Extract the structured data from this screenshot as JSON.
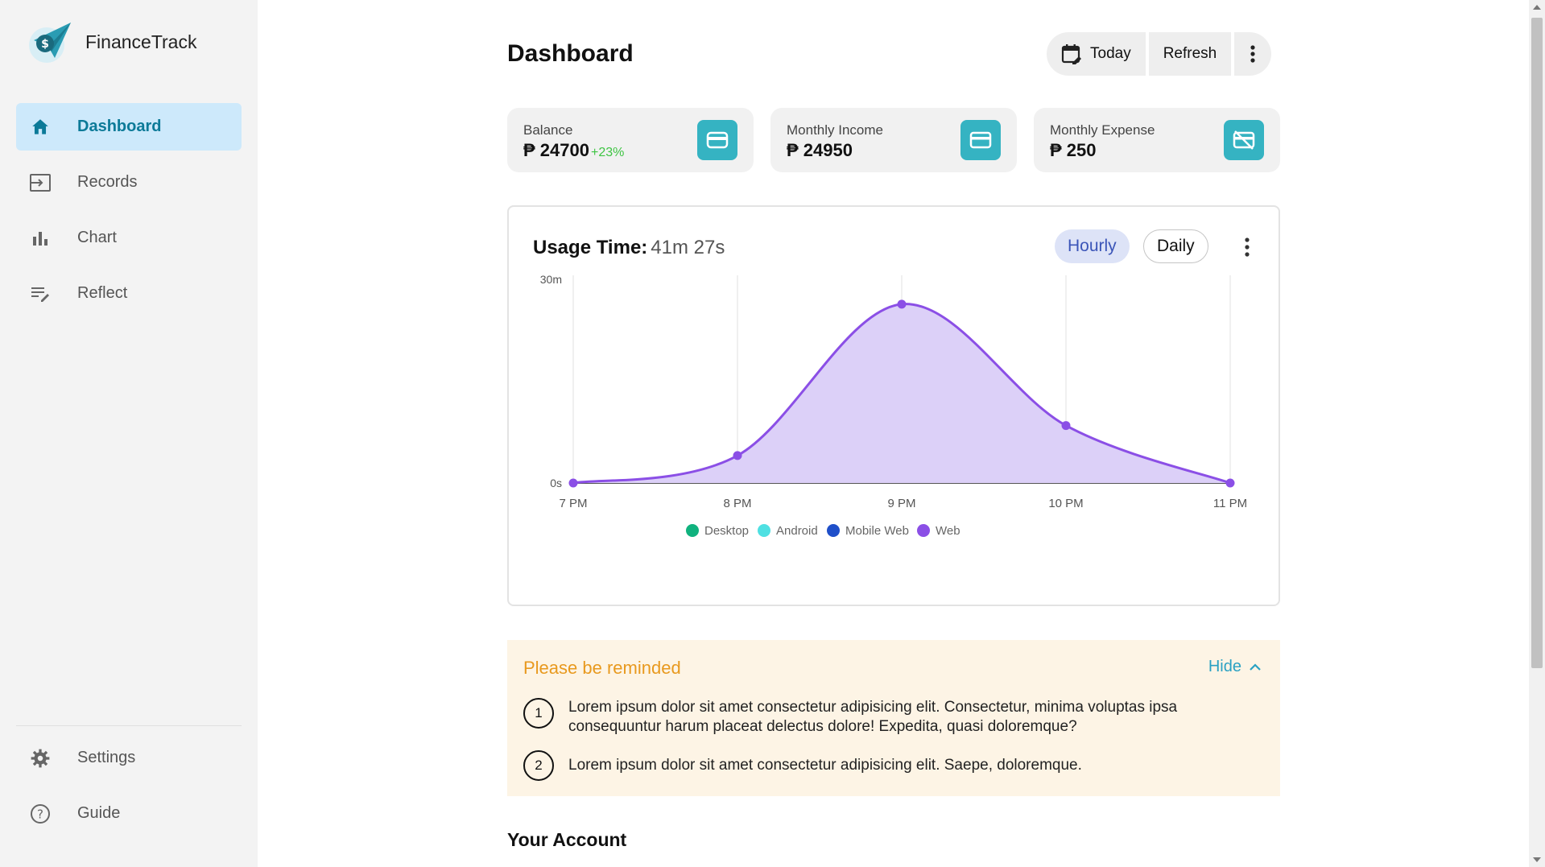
{
  "brand": {
    "name": "FinanceTrack"
  },
  "nav": {
    "items": [
      {
        "label": "Dashboard",
        "active": true
      },
      {
        "label": "Records"
      },
      {
        "label": "Chart"
      },
      {
        "label": "Reflect"
      }
    ],
    "bottom": [
      {
        "label": "Settings"
      },
      {
        "label": "Guide"
      }
    ]
  },
  "header": {
    "title": "Dashboard",
    "today_label": "Today",
    "refresh_label": "Refresh"
  },
  "stats": [
    {
      "label": "Balance",
      "value": "₱ 24700",
      "delta": "+23%"
    },
    {
      "label": "Monthly Income",
      "value": "₱ 24950"
    },
    {
      "label": "Monthly Expense",
      "value": "₱ 250"
    }
  ],
  "colors": {
    "accent": "#35b3c2",
    "nav_active_bg": "#cde9fb",
    "web_series": "#8b4fe6",
    "reminder_bg": "#fdf4e5",
    "reminder_title": "#e8991e"
  },
  "usage": {
    "title": "Usage Time:",
    "value": "41m 27s",
    "toggle_hourly": "Hourly",
    "toggle_daily": "Daily"
  },
  "chart_data": {
    "type": "area",
    "categories": [
      "7 PM",
      "8 PM",
      "9 PM",
      "10 PM",
      "11 PM"
    ],
    "y_ticks": [
      "0s",
      "30m"
    ],
    "ylim": [
      0,
      30
    ],
    "grid": true,
    "legend_position": "bottom",
    "legend": [
      {
        "name": "Desktop",
        "color": "#10b27e"
      },
      {
        "name": "Android",
        "color": "#4fe0e2"
      },
      {
        "name": "Mobile Web",
        "color": "#1f4fc9"
      },
      {
        "name": "Web",
        "color": "#8b4fe6"
      }
    ],
    "series": [
      {
        "name": "Web",
        "values": [
          0,
          4.3,
          28,
          9,
          0
        ]
      }
    ]
  },
  "reminder": {
    "title": "Please be reminded",
    "hide_label": "Hide",
    "items": [
      {
        "num": "1",
        "text": "Lorem ipsum dolor sit amet consectetur adipisicing elit. Consectetur, minima voluptas ipsa consequuntur harum placeat delectus dolore! Expedita, quasi doloremque?"
      },
      {
        "num": "2",
        "text": "Lorem ipsum dolor sit amet consectetur adipisicing elit. Saepe, doloremque."
      }
    ]
  },
  "account": {
    "title": "Your Account"
  }
}
